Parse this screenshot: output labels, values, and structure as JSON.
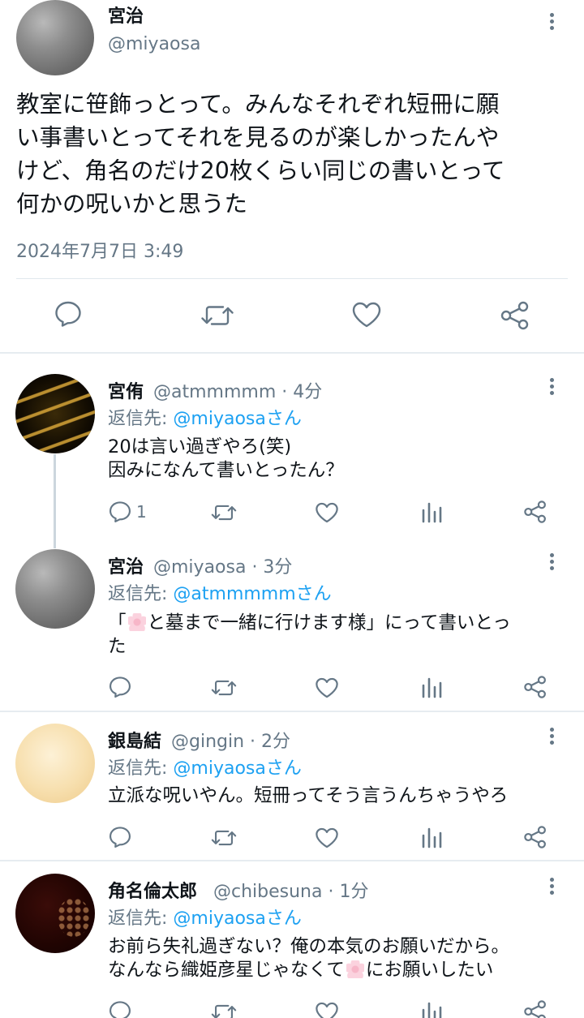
{
  "main_tweet": {
    "name": "宮治",
    "handle": "@miyaosa",
    "text_lines": [
      "教室に笹飾っとって。みんなそれぞれ短冊に願",
      "い事書いとってそれを見るのが楽しかったんや",
      "けど、角名のだけ20枚くらい同じの書いとって",
      "何かの呪いかと思うた"
    ],
    "timestamp": "2024年7月7日 3:49",
    "actions": [
      "reply-icon",
      "retweet-icon",
      "like-icon",
      "share-icon"
    ]
  },
  "replies": [
    {
      "name": "宮侑",
      "handle_time": "@atmmmmm · 4分",
      "reply_prefix": "返信先: ",
      "reply_to": "@miyaosaさん",
      "lines": [
        "20は言い過ぎやろ(笑)",
        "因みになんて書いとったん？"
      ],
      "reply_count": "1"
    },
    {
      "name": "宮治",
      "handle_time": "@miyaosa · 3分",
      "reply_prefix": "返信先: ",
      "reply_to": "@atmmmmmさん",
      "line1_before": "「",
      "line1_after": "と墓まで一緒に行けます様」にって書いとっ",
      "line2": "た",
      "emoji": "cherry-blossom"
    },
    {
      "name": "銀島結",
      "handle_time": "@gingin · 2分",
      "reply_prefix": "返信先: ",
      "reply_to": "@miyaosaさん",
      "lines": [
        "立派な呪いやん。短冊ってそう言うんちゃうやろ"
      ]
    },
    {
      "name": "角名倫太郎",
      "handle_time": "@chibesuna · 1分",
      "reply_prefix": "返信先: ",
      "reply_to": "@miyaosaさん",
      "line1": "お前ら失礼過ぎない？俺の本気のお願いだから。",
      "line2_before": "なんなら織姫彦星じゃなくて",
      "line2_after": "にお願いしたい",
      "emoji": "cherry-blossom"
    }
  ],
  "colors": {
    "text": "#0f1419",
    "secondary": "#657786",
    "mention": "#1da1f2",
    "divider": "#e6ecf0"
  }
}
